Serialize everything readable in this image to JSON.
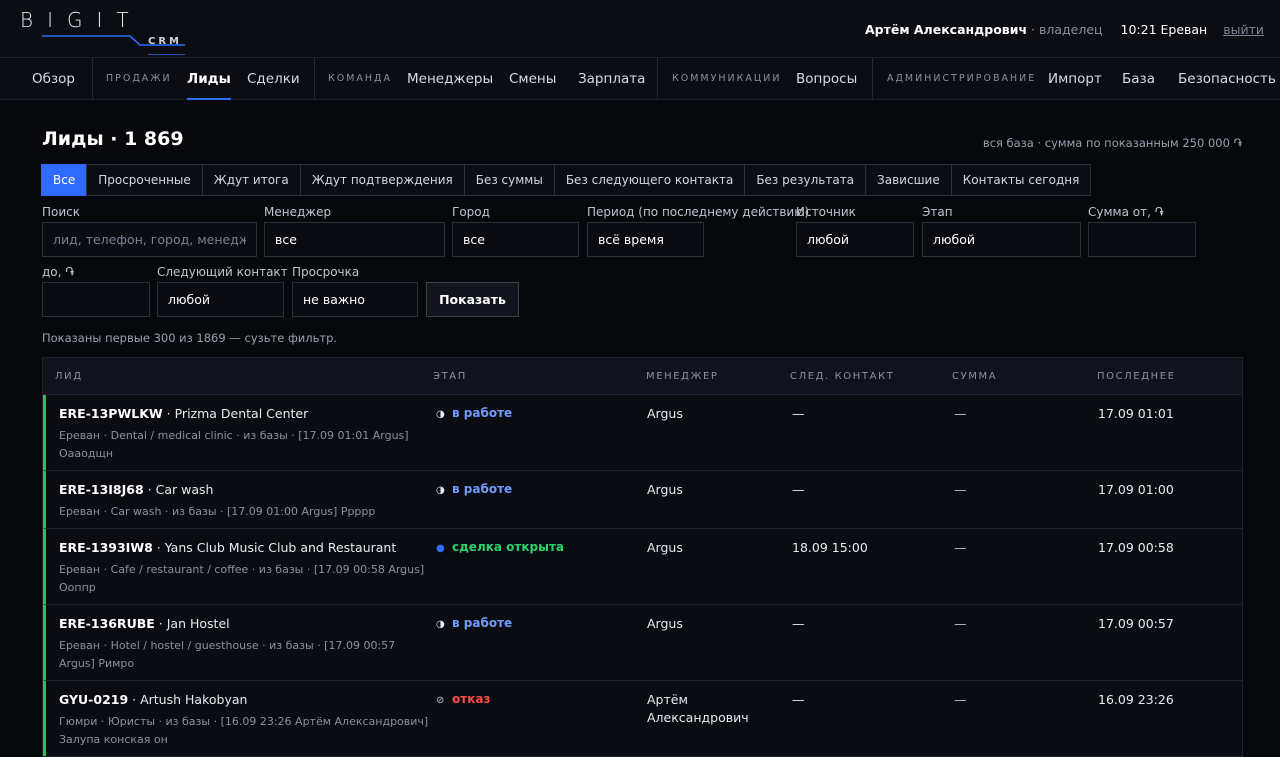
{
  "header": {
    "logo_text": "BIGIT",
    "logo_sub": "CRM",
    "user_name": "Артём Александрович",
    "user_role": "· владелец",
    "clock": "10:21 Ереван",
    "logout": "выйти"
  },
  "nav": {
    "overview": "Обзор",
    "group_sales": "ПРОДАЖИ",
    "leads": "Лиды",
    "deals": "Сделки",
    "group_team": "КОМАНДА",
    "managers": "Менеджеры",
    "shifts": "Смены",
    "salary": "Зарплата",
    "group_comm": "КОММУНИКАЦИИ",
    "questions": "Вопросы",
    "group_admin": "АДМИНИСТРИРОВАНИЕ",
    "import": "Импорт",
    "base": "База",
    "security": "Безопасность"
  },
  "page": {
    "title": "Лиды · 1 869",
    "sum_note": "вся база · сумма по показанным 250 000 ֏",
    "hint": "Показаны первые 300 из 1869 — сузьте фильтр."
  },
  "tabs": [
    "Все",
    "Просроченные",
    "Ждут итога",
    "Ждут подтверждения",
    "Без суммы",
    "Без следующего контакта",
    "Без результата",
    "Зависшие",
    "Контакты сегодня"
  ],
  "filters": {
    "search_label": "Поиск",
    "search_placeholder": "лид, телефон, город, менеджер",
    "manager_label": "Менеджер",
    "manager_value": "все",
    "city_label": "Город",
    "city_value": "все",
    "period_label": "Период (по последнему действию)",
    "period_value": "всё время",
    "source_label": "Источник",
    "source_value": "любой",
    "stage_label": "Этап",
    "stage_value": "любой",
    "sum_from_label": "Сумма от, ֏",
    "sum_from_value": "",
    "sum_to_label": "до, ֏",
    "sum_to_value": "",
    "next_contact_label": "Следующий контакт",
    "next_contact_value": "любой",
    "overdue_label": "Просрочка",
    "overdue_value": "не важно",
    "show_button": "Показать"
  },
  "table": {
    "headers": {
      "lead": "ЛИД",
      "stage": "ЭТАП",
      "manager": "МЕНЕДЖЕР",
      "next_contact": "СЛЕД. КОНТАКТ",
      "sum": "СУММА",
      "last": "ПОСЛЕДНЕЕ"
    },
    "rows": [
      {
        "id": "ERE-13PWLKW",
        "name": " · Prizma Dental Center",
        "sub": "Ереван · Dental / medical clinic · из базы · [17.09 01:01 Argus] Оааодщн",
        "stage_icon": "◑",
        "stage": "в работе",
        "manager": "Argus",
        "next_contact": "—",
        "sum": "—",
        "last": "17.09 01:01"
      },
      {
        "id": "ERE-13I8J68",
        "name": " · Car wash",
        "sub": "Ереван · Car wash · из базы · [17.09 01:00 Argus] Ррррр",
        "stage_icon": "◑",
        "stage": "в работе",
        "manager": "Argus",
        "next_contact": "—",
        "sum": "—",
        "last": "17.09 01:00"
      },
      {
        "id": "ERE-1393IW8",
        "name": " · Yans Club Music Club and Restaurant",
        "sub": "Ереван · Cafe / restaurant / coffee · из базы · [17.09 00:58 Argus] Ооппр",
        "stage_icon": "●",
        "stage": "сделка открыта",
        "manager": "Argus",
        "next_contact": "18.09 15:00",
        "sum": "—",
        "last": "17.09 00:58"
      },
      {
        "id": "ERE-136RUBE",
        "name": " · Jan Hostel",
        "sub": "Ереван · Hotel / hostel / guesthouse · из базы · [17.09 00:57 Argus] Римро",
        "stage_icon": "◑",
        "stage": "в работе",
        "manager": "Argus",
        "next_contact": "—",
        "sum": "—",
        "last": "17.09 00:57"
      },
      {
        "id": "GYU-0219",
        "name": " · Artush Hakobyan",
        "sub": "Гюмри · Юристы · из базы · [16.09 23:26 Артём Александрович] Залупа конская он",
        "stage_icon": "⊘",
        "stage": "отказ",
        "manager": "Артём Александрович",
        "next_contact": "—",
        "sum": "—",
        "last": "16.09 23:26"
      }
    ]
  },
  "colors": {
    "accent": "#2f6bff",
    "stage_work": "#6f9bff",
    "stage_deal": "#2ad36b",
    "stage_deal_icon": "#2f6bff",
    "stage_refuse": "#ff4d4d",
    "row_marker": "#21c45d"
  }
}
